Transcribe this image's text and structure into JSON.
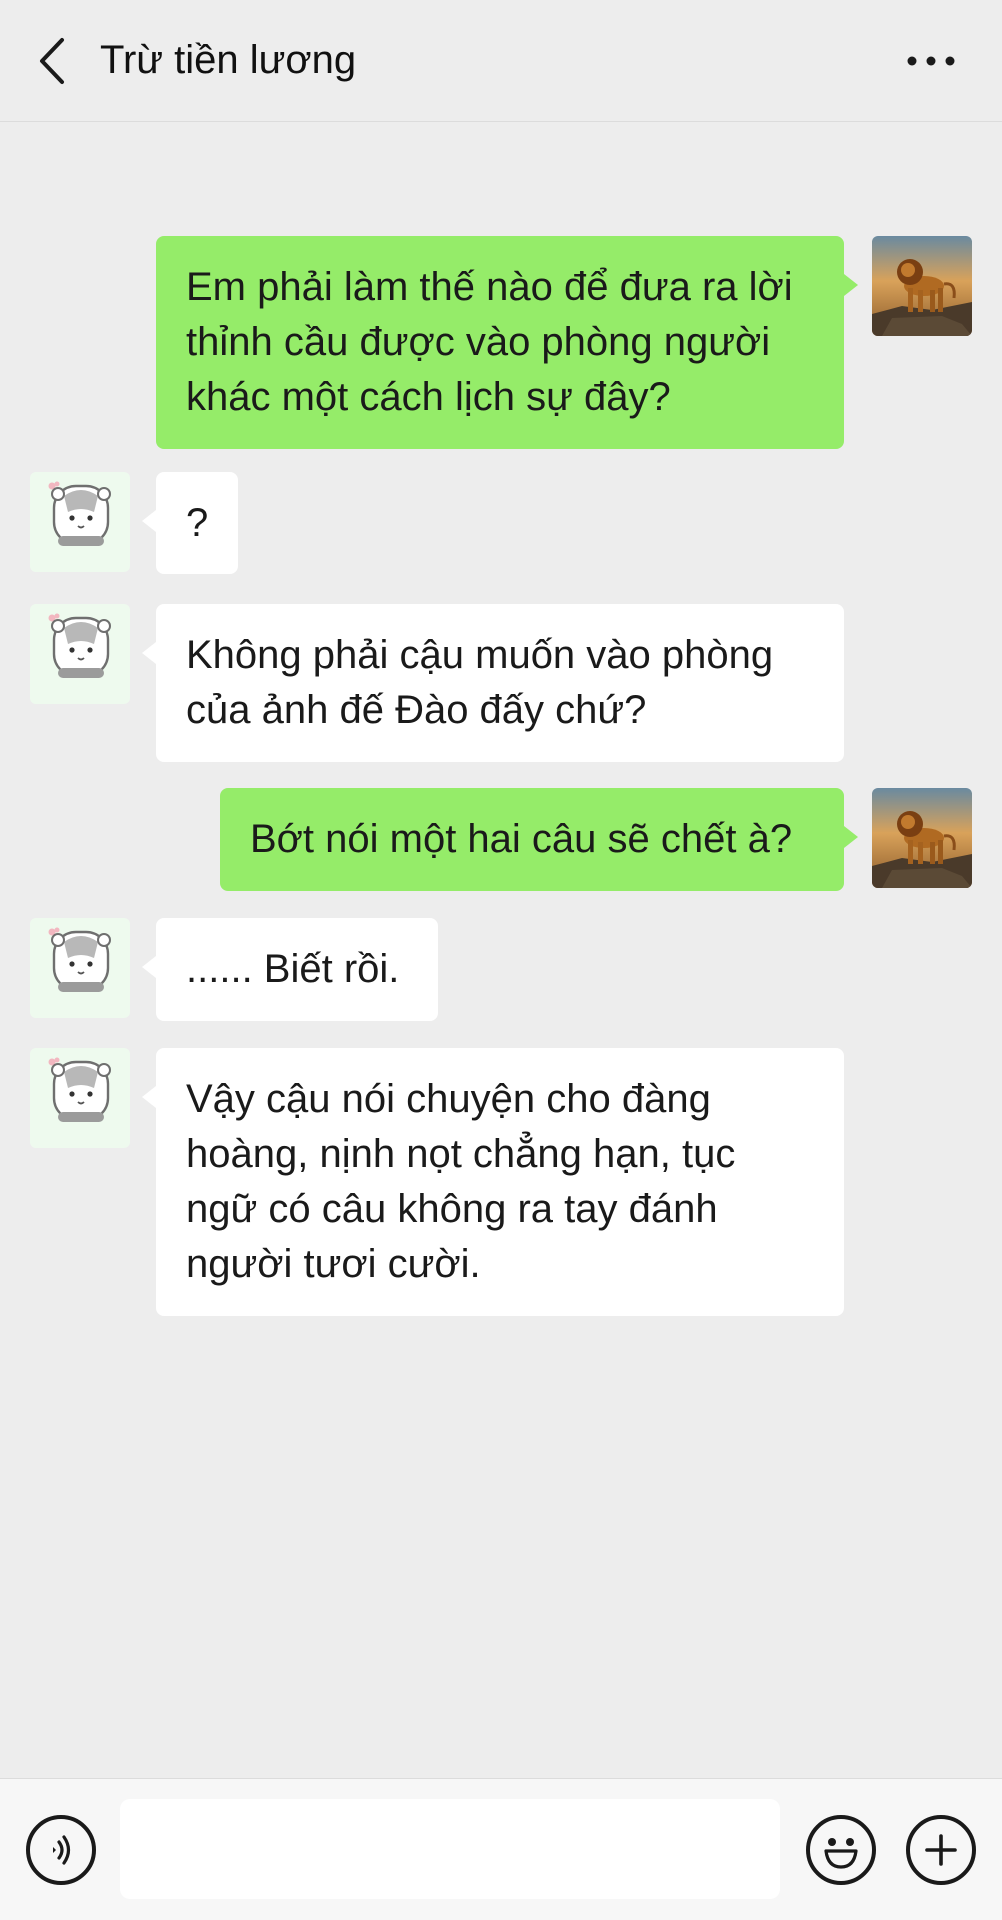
{
  "header": {
    "title": "Trừ tiền lương",
    "back_icon": "chevron-left-icon",
    "more_icon": "more-dots-icon"
  },
  "avatars": {
    "me": "lion-avatar",
    "them": "hamster-avatar"
  },
  "messages": [
    {
      "sender": "me",
      "text": "Em phải làm thế nào để đưa ra lời thỉnh cầu được vào phòng người khác một cách lịch sự đây?"
    },
    {
      "sender": "them",
      "text": "?"
    },
    {
      "sender": "them",
      "text": "Không phải cậu muốn vào phòng của ảnh đế Đào đấy chứ?"
    },
    {
      "sender": "me",
      "text": "Bớt nói một hai câu sẽ chết à?"
    },
    {
      "sender": "them",
      "text": "...... Biết rồi."
    },
    {
      "sender": "them",
      "text": "Vậy cậu nói chuyện cho đàng hoàng, nịnh nọt chẳng hạn, tục ngữ có câu không ra tay đánh người tươi cười."
    }
  ],
  "input_bar": {
    "voice_icon": "voice-icon",
    "message_value": "",
    "emoji_icon": "emoji-icon",
    "add_icon": "plus-icon"
  },
  "colors": {
    "background": "#ededed",
    "my_bubble": "#95ec69",
    "their_bubble": "#ffffff"
  }
}
